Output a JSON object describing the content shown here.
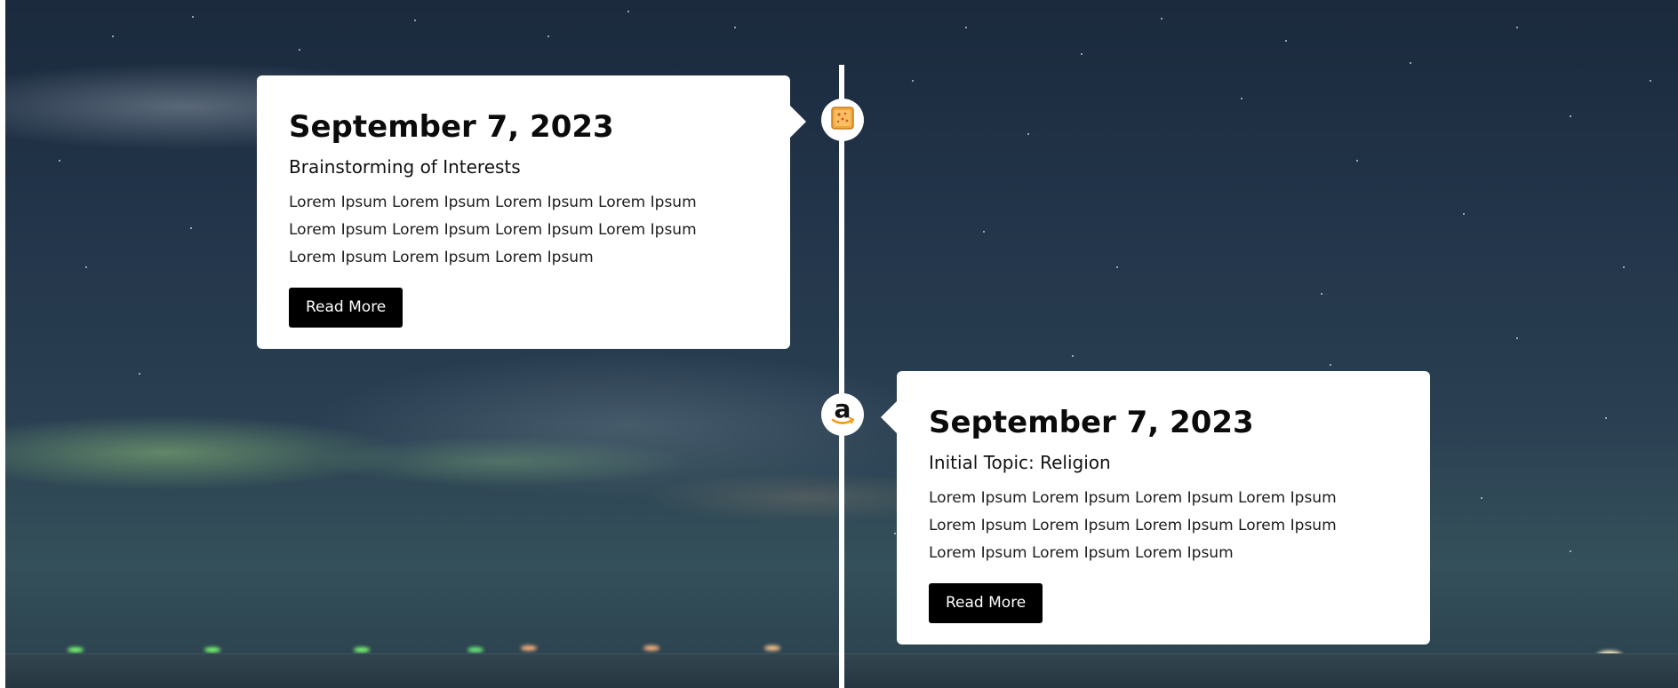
{
  "timeline": {
    "entries": [
      {
        "date": "September 7, 2023",
        "subtitle": "Brainstorming of Interests",
        "body": "Lorem Ipsum Lorem Ipsum Lorem Ipsum Lorem Ipsum Lorem Ipsum Lorem Ipsum Lorem Ipsum Lorem Ipsum Lorem Ipsum Lorem Ipsum Lorem Ipsum",
        "button_label": "Read More",
        "icon": "cheese-toast-icon"
      },
      {
        "date": "September 7, 2023",
        "subtitle": "Initial Topic: Religion",
        "body": "Lorem Ipsum Lorem Ipsum Lorem Ipsum Lorem Ipsum Lorem Ipsum Lorem Ipsum Lorem Ipsum Lorem Ipsum Lorem Ipsum Lorem Ipsum Lorem Ipsum",
        "button_label": "Read More",
        "icon": "amazon-logo-icon"
      }
    ]
  },
  "colors": {
    "card_background": "#ffffff",
    "button_background": "#000000",
    "button_text": "#ffffff",
    "timeline_line": "#ffffff"
  }
}
